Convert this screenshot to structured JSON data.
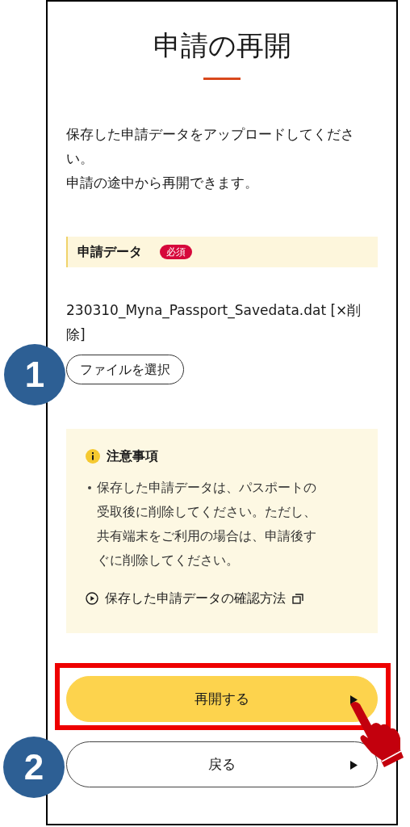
{
  "title": "申請の再開",
  "intro": [
    "保存した申請データをアップロードしてください。",
    "申請の途中から再開できます。"
  ],
  "field": {
    "label": "申請データ",
    "badge": "必須",
    "file_name": "230310_Myna_Passport_Savedata.dat [×削除]",
    "file_button": "ファイルを選択"
  },
  "notice": {
    "heading": "注意事項",
    "items": [
      "保存した申請データは、パスポートの受取後に削除してください。ただし、共有端末をご利用の場合は、申請後すぐに削除してください。"
    ],
    "link": "保存した申請データの確認方法"
  },
  "buttons": [
    {
      "label": "再開する",
      "kind": "primary",
      "highlighted": true
    },
    {
      "label": "戻る",
      "kind": "secondary",
      "highlighted": false
    }
  ],
  "step_markers": [
    "1",
    "2"
  ]
}
